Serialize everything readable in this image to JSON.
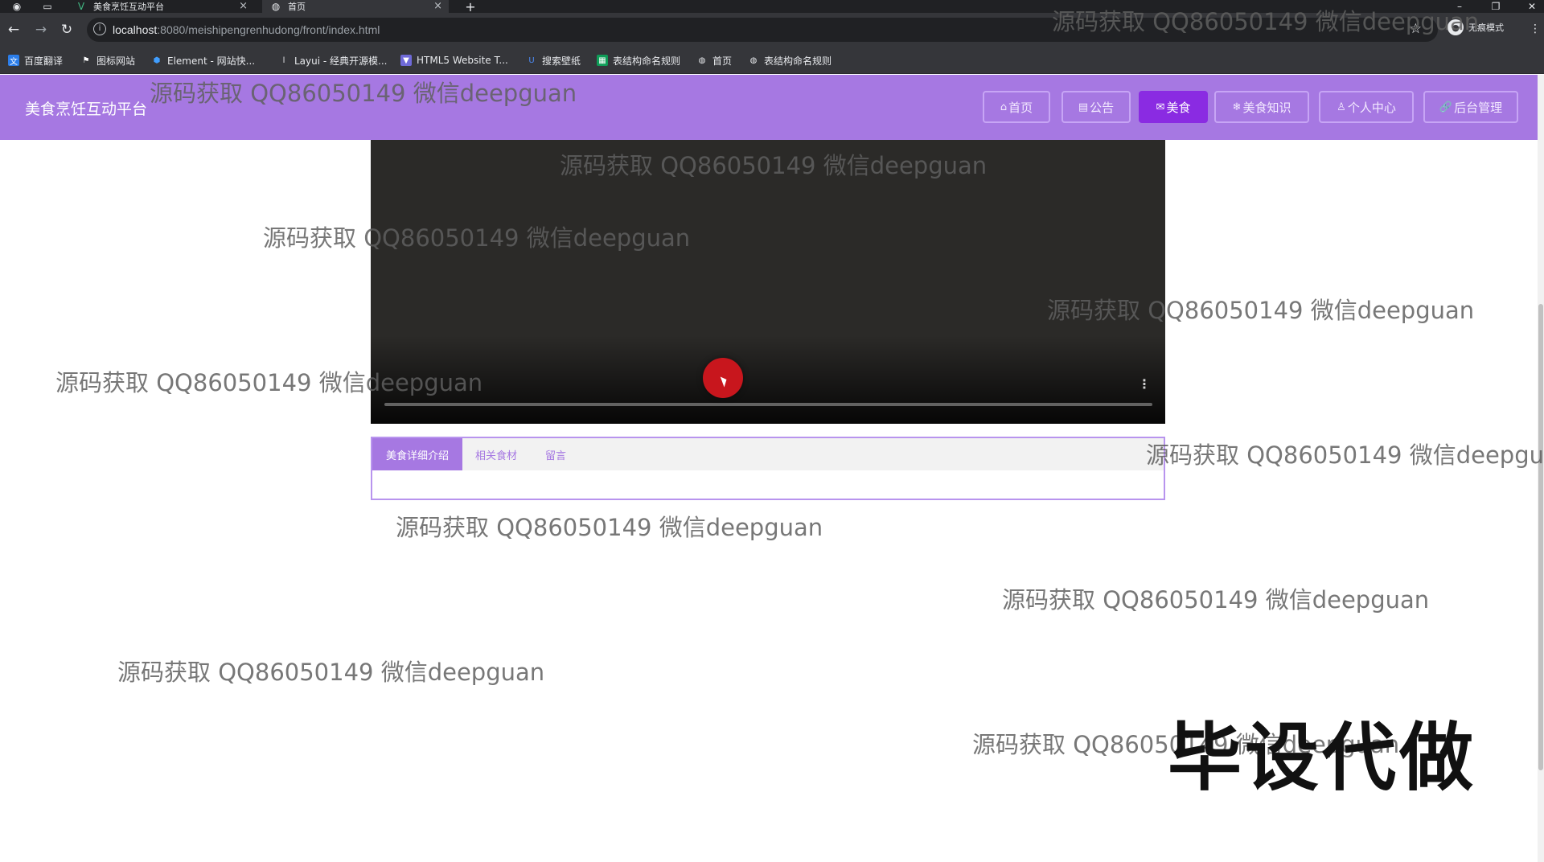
{
  "browser": {
    "tabs": [
      {
        "label": "美食烹饪互动平台",
        "icon": "vue-icon",
        "active": false
      },
      {
        "label": "首页",
        "icon": "globe-icon",
        "active": true
      }
    ],
    "new_tab": "+",
    "tab_close": "×",
    "address": {
      "host": "localhost",
      "path": ":8080/meishipengrenhudong/front/index.html"
    },
    "profile_label": "无痕模式",
    "bookmarks": [
      {
        "label": "百度翻译",
        "icon": "translate-icon"
      },
      {
        "label": "图标网站",
        "icon": "flag-icon"
      },
      {
        "label": "Element - 网站快...",
        "icon": "element-icon"
      },
      {
        "label": "Layui - 经典开源模...",
        "icon": "layui-icon"
      },
      {
        "label": "HTML5 Website T...",
        "icon": "html5-icon"
      },
      {
        "label": "搜索壁纸",
        "icon": "wallpaper-icon"
      },
      {
        "label": "表结构命名规则",
        "icon": "sheet-icon"
      },
      {
        "label": "首页",
        "icon": "globe-icon"
      },
      {
        "label": "表结构命名规则",
        "icon": "globe-icon"
      }
    ]
  },
  "site": {
    "title": "美食烹饪互动平台",
    "nav": [
      {
        "label": "首页",
        "icon": "⌂",
        "active": false
      },
      {
        "label": "公告",
        "icon": "▤",
        "active": false
      },
      {
        "label": "美食",
        "icon": "✉",
        "active": true
      },
      {
        "label": "美食知识",
        "icon": "❄",
        "active": false
      },
      {
        "label": "个人中心",
        "icon": "♙",
        "active": false
      },
      {
        "label": "后台管理",
        "icon": "🔗",
        "active": false
      }
    ]
  },
  "video": {
    "progress": 0,
    "more": "⋮"
  },
  "detail_tabs": [
    {
      "label": "美食详细介绍",
      "active": true
    },
    {
      "label": "相关食材",
      "active": false
    },
    {
      "label": "留言",
      "active": false
    }
  ],
  "watermark_text": "源码获取 QQ86050149 微信deepguan",
  "stamp_text": "毕设代做",
  "colors": {
    "header": "#a678e2",
    "nav_active": "#8a2be2",
    "panel_border": "#b894ee"
  }
}
